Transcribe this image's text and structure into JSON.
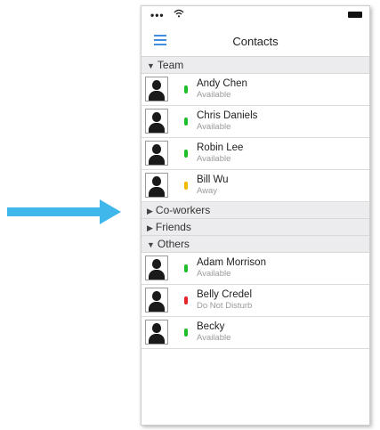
{
  "colors": {
    "accent": "#3f8ee0",
    "arrow": "#3fb7ea",
    "available": "#1fbf2a",
    "away": "#f5b800",
    "dnd": "#e52525"
  },
  "header": {
    "title": "Contacts"
  },
  "groups": [
    {
      "label": "Team",
      "expanded": true,
      "contacts": [
        {
          "name": "Andy Chen",
          "status": "Available",
          "status_type": "available"
        },
        {
          "name": "Chris Daniels",
          "status": "Available",
          "status_type": "available"
        },
        {
          "name": "Robin Lee",
          "status": "Available",
          "status_type": "available"
        },
        {
          "name": "Bill Wu",
          "status": "Away",
          "status_type": "away"
        }
      ]
    },
    {
      "label": "Co-workers",
      "expanded": false,
      "contacts": []
    },
    {
      "label": "Friends",
      "expanded": false,
      "contacts": []
    },
    {
      "label": "Others",
      "expanded": true,
      "contacts": [
        {
          "name": "Adam Morrison",
          "status": "Available",
          "status_type": "available"
        },
        {
          "name": "Belly Credel",
          "status": "Do Not Disturb",
          "status_type": "dnd"
        },
        {
          "name": "Becky",
          "status": "Available",
          "status_type": "available"
        }
      ]
    }
  ],
  "icons": {
    "menu": "hamburger-menu-icon",
    "arrow": "right-arrow-icon",
    "expanded": "triangle-down-icon",
    "collapsed": "triangle-right-icon",
    "avatar": "person-silhouette-icon"
  }
}
